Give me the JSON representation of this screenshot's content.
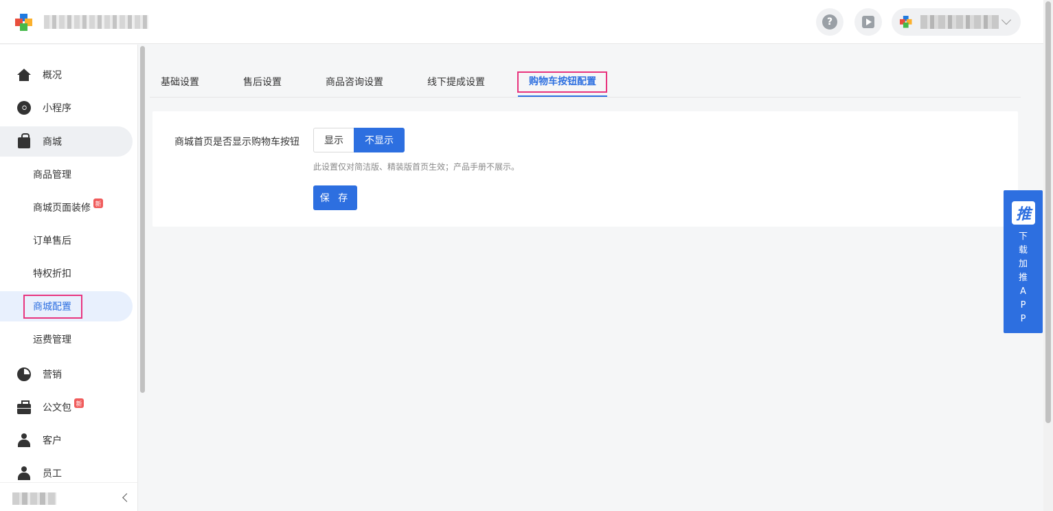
{
  "header": {
    "help_icon": "question-circle-icon",
    "video_icon": "video-play-icon",
    "help_glyph": "?"
  },
  "sidebar": {
    "items": [
      {
        "label": "概况",
        "icon": "home-icon"
      },
      {
        "label": "小程序",
        "icon": "mini-program-icon"
      },
      {
        "label": "商城",
        "icon": "shopping-bag-icon"
      },
      {
        "label": "营销",
        "icon": "pie-chart-icon"
      },
      {
        "label": "公文包",
        "icon": "briefcase-icon",
        "badge": "新"
      },
      {
        "label": "客户",
        "icon": "customer-icon"
      },
      {
        "label": "员工",
        "icon": "staff-icon"
      }
    ],
    "mall_sub": [
      {
        "label": "商品管理"
      },
      {
        "label": "商城页面装修",
        "badge": "新"
      },
      {
        "label": "订单售后"
      },
      {
        "label": "特权折扣"
      },
      {
        "label": "商城配置"
      },
      {
        "label": "运费管理"
      }
    ]
  },
  "tabs": [
    {
      "label": "基础设置"
    },
    {
      "label": "售后设置"
    },
    {
      "label": "商品咨询设置"
    },
    {
      "label": "线下提成设置"
    },
    {
      "label": "购物车按钮配置"
    }
  ],
  "form": {
    "label": "商城首页是否显示购物车按钮",
    "option_show": "显示",
    "option_hide": "不显示",
    "selected": "不显示",
    "hint": "此设置仅对简洁版、精装版首页生效；产品手册不展示。",
    "save": "保 存"
  },
  "float_app": {
    "logo": "推",
    "text": [
      "下",
      "载",
      "加",
      "推",
      "A",
      "P",
      "P"
    ]
  },
  "colors": {
    "accent": "#2d6fe0",
    "highlight": "#e8337d",
    "badge": "#f05b5b"
  }
}
